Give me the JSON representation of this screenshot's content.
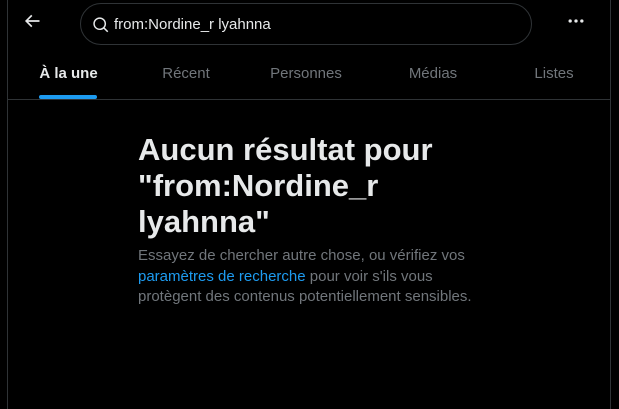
{
  "header": {
    "back_icon": "arrow-left-icon",
    "search": {
      "icon": "search-icon",
      "value": "from:Nordine_r lyahnna",
      "placeholder": ""
    },
    "more_icon": "more-horizontal-icon"
  },
  "tabs": [
    {
      "label": "À la une",
      "active": true
    },
    {
      "label": "Récent",
      "active": false
    },
    {
      "label": "Personnes",
      "active": false
    },
    {
      "label": "Médias",
      "active": false
    },
    {
      "label": "Listes",
      "active": false
    }
  ],
  "empty_state": {
    "title": "Aucun résultat pour \"from:Nordine_r lyahnna\"",
    "text_before_link": "Essayez de chercher autre chose, ou vérifiez vos ",
    "link_label": "paramètres de recherche",
    "text_after_link": " pour voir s'ils vous protègent des contenus potentiellement sensibles."
  },
  "colors": {
    "background": "#000000",
    "text_primary": "#e7e9ea",
    "text_secondary": "#71767b",
    "accent": "#1d9bf0",
    "border": "#2f3336"
  }
}
